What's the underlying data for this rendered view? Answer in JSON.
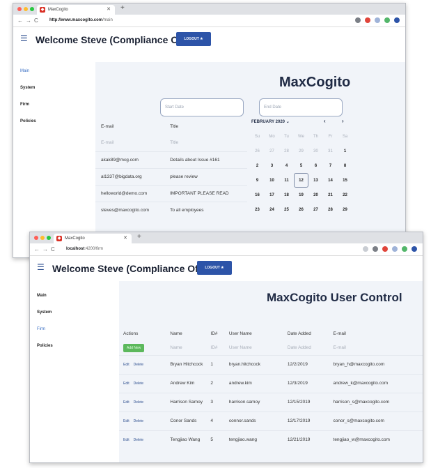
{
  "win1": {
    "tab_title": "MaxCogito",
    "url_host": "http://www.maxcogito.com",
    "url_path": "/main",
    "header_title": "Welcome Steve (Compliance Officer)",
    "logout_label": "LOGOUT",
    "sidebar": [
      "Main",
      "System",
      "Firm",
      "Policies"
    ],
    "brand": "MaxCogito",
    "start_placeholder": "Start Date",
    "end_placeholder": "End Date",
    "email_table": {
      "headers": [
        "E-mail",
        "Title"
      ],
      "filters": [
        "E-mail",
        "Title"
      ],
      "rows": [
        [
          "akak89@mcg.com",
          "Details about Issue #161"
        ],
        [
          "al1337@bigdata.org",
          "please review"
        ],
        [
          "helloworld@demo.com",
          "IMPORTANT PLEASE READ"
        ],
        [
          "steves@maxcogito.com",
          "To all employees"
        ]
      ]
    },
    "calendar": {
      "month": "FEBRUARY 2020",
      "prev": "‹",
      "next": "›",
      "weekdays": [
        "Su",
        "Mo",
        "Tu",
        "We",
        "Th",
        "Fr",
        "Sa"
      ],
      "weeks": [
        [
          "26",
          "27",
          "28",
          "29",
          "30",
          "31",
          "1"
        ],
        [
          "2",
          "3",
          "4",
          "5",
          "6",
          "7",
          "8"
        ],
        [
          "9",
          "10",
          "11",
          "12",
          "13",
          "14",
          "15"
        ],
        [
          "16",
          "17",
          "18",
          "19",
          "20",
          "21",
          "22"
        ],
        [
          "23",
          "24",
          "25",
          "26",
          "27",
          "28",
          "29"
        ]
      ],
      "selected": "12"
    }
  },
  "win2": {
    "tab_title": "MaxCogito",
    "url_host": "localhost",
    "url_path": ":4200/firm",
    "header_title": "Welcome Steve (Compliance Officer)",
    "logout_label": "LOGOUT",
    "sidebar": [
      "Main",
      "System",
      "Firm",
      "Policies"
    ],
    "brand": "MaxCogito User Control",
    "table": {
      "headers": [
        "Actions",
        "Name",
        "ID#",
        "User Name",
        "Date Added",
        "E-mail"
      ],
      "new_button": "Add New",
      "filters": [
        "Name",
        "ID#",
        "User Name",
        "Date Added",
        "E-mail"
      ],
      "edit_label": "Edit",
      "delete_label": "Delete",
      "rows": [
        [
          "Bryan Hitchcock",
          "1",
          "bryan.hitchcock",
          "12/2/2019",
          "bryan_h@maxcogito.com"
        ],
        [
          "Andrew Kim",
          "2",
          "andrew.kim",
          "12/3/2019",
          "andrew_k@maxcogito.com"
        ],
        [
          "Harrison Samoy",
          "3",
          "harrison.samoy",
          "12/15/2019",
          "harrison_s@maxcogito.com"
        ],
        [
          "Conor Sands",
          "4",
          "connor.sands",
          "12/17/2019",
          "conor_s@maxcogito.com"
        ],
        [
          "Tengjiao Wang",
          "5",
          "tengjiao.wang",
          "12/21/2019",
          "tengjiao_w@maxcogito.com"
        ]
      ]
    }
  },
  "colors": {
    "accent": "#2d54a8",
    "background": "#f1f4f9",
    "add_button": "#5cb85c"
  }
}
